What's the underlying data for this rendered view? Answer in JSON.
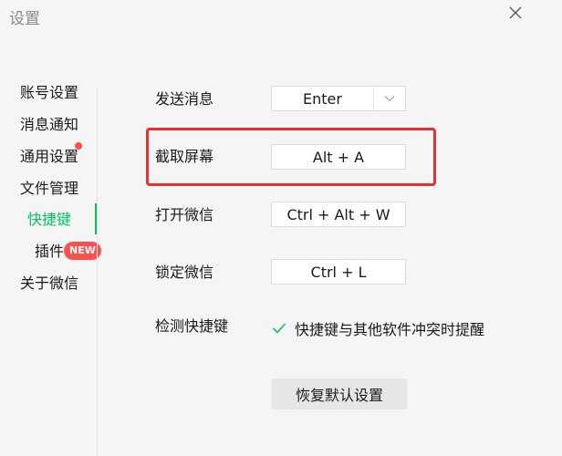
{
  "window": {
    "title": "设置",
    "close_icon": "close-icon"
  },
  "sidebar": {
    "items": [
      {
        "label": "账号设置"
      },
      {
        "label": "消息通知"
      },
      {
        "label": "通用设置",
        "has_dot": true
      },
      {
        "label": "文件管理"
      },
      {
        "label": "快捷键",
        "active": true
      },
      {
        "label": "插件",
        "badge": "NEW"
      },
      {
        "label": "关于微信"
      }
    ]
  },
  "shortcuts": {
    "send": {
      "label": "发送消息",
      "value": "Enter"
    },
    "screenshot": {
      "label": "截取屏幕",
      "value": "Alt + A"
    },
    "open_wechat": {
      "label": "打开微信",
      "value": "Ctrl + Alt + W"
    },
    "lock_wechat": {
      "label": "锁定微信",
      "value": "Ctrl + L"
    },
    "detect": {
      "label": "检测快捷键",
      "checkbox_label": "快捷键与其他软件冲突时提醒",
      "checked": true
    }
  },
  "restore_button": {
    "label": "恢复默认设置"
  },
  "colors": {
    "accent": "#07c160",
    "highlight": "#e8312e",
    "badge": "#fa5151"
  }
}
